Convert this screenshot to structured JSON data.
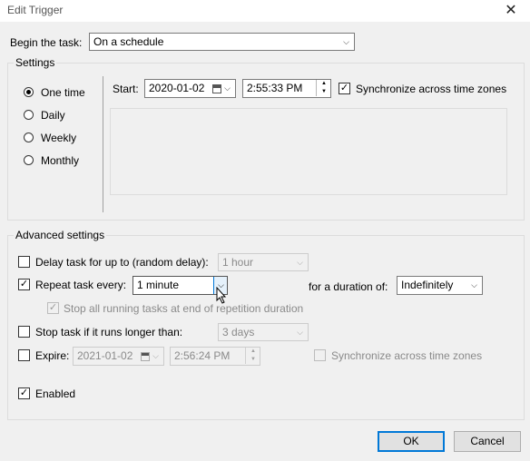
{
  "window": {
    "title": "Edit Trigger",
    "close_glyph": "✕"
  },
  "begin": {
    "label": "Begin the task:",
    "value": "On a schedule"
  },
  "settings": {
    "legend": "Settings",
    "radios": [
      {
        "label": "One time",
        "checked": true
      },
      {
        "label": "Daily",
        "checked": false
      },
      {
        "label": "Weekly",
        "checked": false
      },
      {
        "label": "Monthly",
        "checked": false
      }
    ],
    "start_label": "Start:",
    "start_date": "2020-01-02",
    "start_time": "2:55:33 PM",
    "sync_label": "Synchronize across time zones"
  },
  "advanced": {
    "legend": "Advanced settings",
    "delay_label": "Delay task for up to (random delay):",
    "delay_value": "1 hour",
    "repeat_label": "Repeat task every:",
    "repeat_value": "1 minute",
    "duration_label": "for a duration of:",
    "duration_value": "Indefinitely",
    "stop_running_label": "Stop all running tasks at end of repetition duration",
    "stop_longer_label": "Stop task if it runs longer than:",
    "stop_longer_value": "3 days",
    "expire_label": "Expire:",
    "expire_date": "2021-01-02",
    "expire_time": "2:56:24 PM",
    "expire_sync_label": "Synchronize across time zones",
    "enabled_label": "Enabled"
  },
  "buttons": {
    "ok": "OK",
    "cancel": "Cancel"
  },
  "glyphs": {
    "check": "✓",
    "arrow": "⌵",
    "up": "▲",
    "down": "▼"
  },
  "colors": {
    "accent": "#0078d7",
    "window": "#f0f0f0"
  }
}
